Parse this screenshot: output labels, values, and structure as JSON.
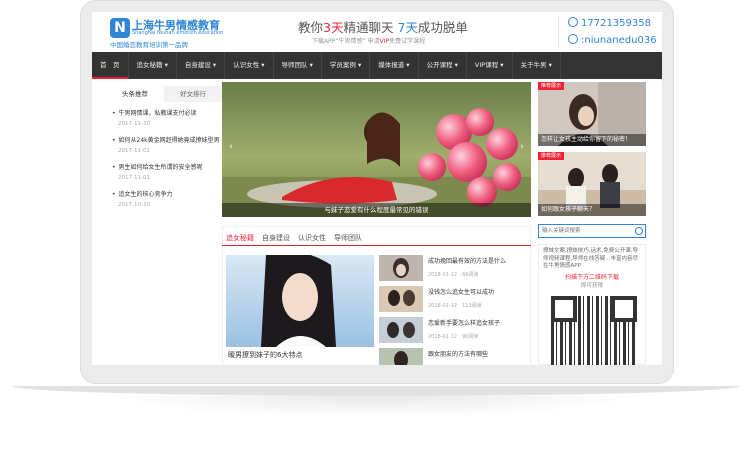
{
  "header": {
    "logo_mark": "N",
    "logo_cn": "上海牛男情感教育",
    "logo_en": "Shanghai Niunan emotion education",
    "logo_sub": "中国婚恋教育培训第一品牌",
    "slogan_a": "教你",
    "slogan_b": "3天",
    "slogan_c": "精通聊天 ",
    "slogan_d": "7天",
    "slogan_e": "成功脱单",
    "sub_a": "下载APP“牛男情感” 申请",
    "sub_b": "VIP",
    "sub_c": "免费试学课程",
    "phone": "17721359358",
    "wechat": ":niunanedu036"
  },
  "nav": {
    "items": [
      {
        "label": "首　页",
        "active": true
      },
      {
        "label": "追女秘籍 ▾"
      },
      {
        "label": "自身建设 ▾"
      },
      {
        "label": "认识女性 ▾"
      },
      {
        "label": "导师团队 ▾"
      },
      {
        "label": "学员案例 ▾"
      },
      {
        "label": "媒体报道 ▾"
      },
      {
        "label": "公开课程 ▾"
      },
      {
        "label": "VIP课程 ▾"
      },
      {
        "label": "关于牛男 ▾"
      }
    ]
  },
  "left": {
    "tabs": [
      "头条推荐",
      "好文排行"
    ],
    "items": [
      {
        "title": "牛男网情课，私教课支付必读",
        "date": "2017-11-30"
      },
      {
        "title": "如何从24k黄金网赶得她竟成撩妹型男",
        "date": "2017-11-02"
      },
      {
        "title": "男生如何给女生所谓的安全感呢",
        "date": "2017-11-01"
      },
      {
        "title": "追女生的核心竞争力",
        "date": "2017-10-30"
      }
    ]
  },
  "slider": {
    "caption": "与妹子恋爱有什么程度最常见的错误",
    "prev": "‹",
    "next": "›"
  },
  "side": {
    "cards": [
      {
        "badge": "推荐展示",
        "caption": "怎样让女孩主动给你留下的秘密！"
      },
      {
        "badge": "推荐展示",
        "caption": "如何跟女孩子聊天？"
      }
    ]
  },
  "search": {
    "placeholder": "输入关键词搜索"
  },
  "promo": {
    "text": "撩妹文案,撩妹技巧,话术,免费公开课,导师视频课程,导师在线答疑...丰富内容尽在牛男情感APP",
    "cta": "扫描下方二维码下载",
    "link": "即可获得"
  },
  "content": {
    "tabs": [
      "追女秘籍",
      "自身建设",
      "认识女性",
      "导师团队"
    ],
    "featured_title": "暧男撩到妹子的6大特点",
    "news": [
      {
        "title": "成功挽回最有效的方法是什么",
        "date": "2018-01-12",
        "views": "66阅读"
      },
      {
        "title": "没钱怎么追女生可以成功",
        "date": "2018-01-12",
        "views": "113阅读"
      },
      {
        "title": "恋爱新手要怎么样追女孩子",
        "date": "2018-01-12",
        "views": "90阅读"
      },
      {
        "title": "跟女朋友的方法有哪些",
        "date": "",
        "views": ""
      }
    ]
  },
  "colors": {
    "brand": "#2f86d6",
    "accent": "#e23",
    "nav_bg": "#333"
  }
}
